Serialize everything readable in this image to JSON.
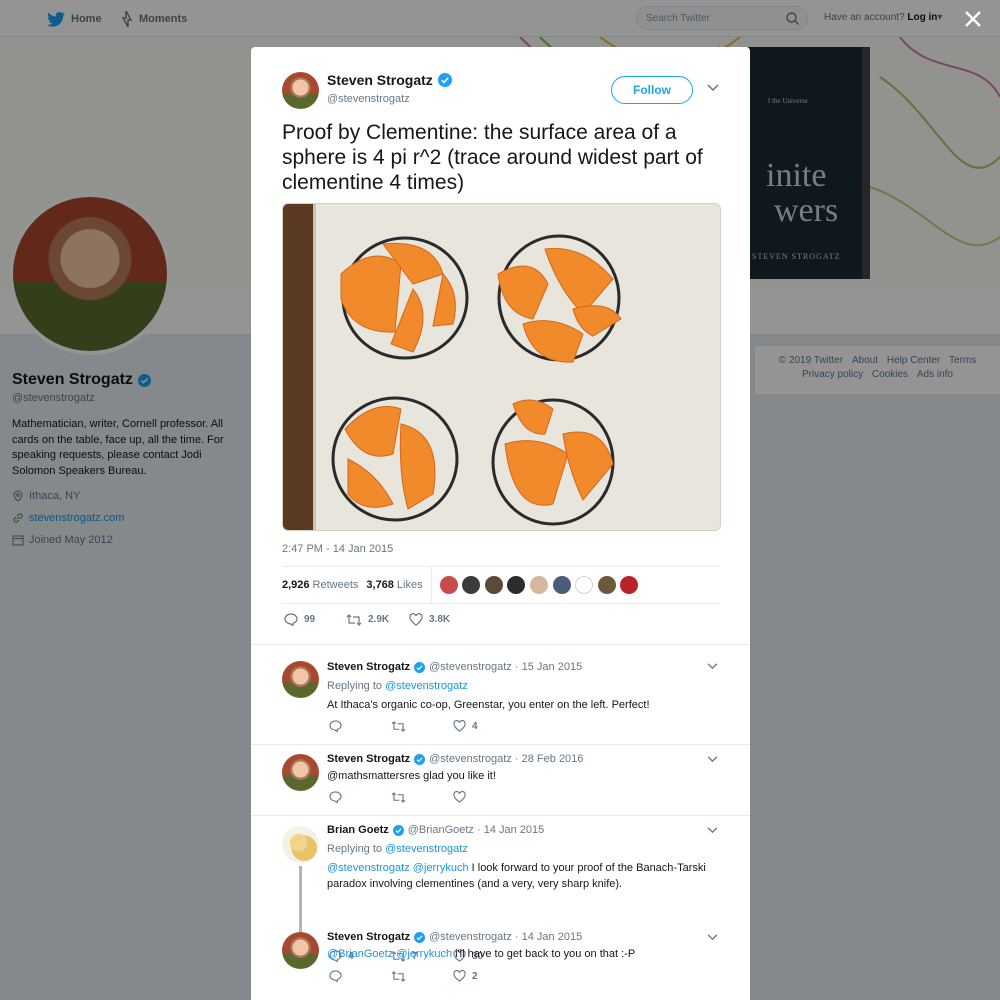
{
  "nav": {
    "home": "Home",
    "moments": "Moments",
    "search_placeholder": "Search Twitter",
    "have_account": "Have an account?",
    "login": "Log in"
  },
  "banner": {
    "book_line1": "inite",
    "book_line2": "wers",
    "book_author": "STEVEN STROGATZ",
    "book_sub1": "f the Universe"
  },
  "profile": {
    "name": "Steven Strogatz",
    "handle": "@stevenstrogatz",
    "bio": "Mathematician, writer, Cornell professor. All cards on the table, face up, all the time. For speaking requests, please contact Jodi Solomon Speakers Bureau.",
    "location": "Ithaca, NY",
    "website": "stevenstrogatz.com",
    "joined": "Joined May 2012"
  },
  "footer": {
    "copyright": "© 2019 Twitter",
    "about": "About",
    "help": "Help Center",
    "terms": "Terms",
    "privacy": "Privacy policy",
    "cookies": "Cookies",
    "ads": "Ads info"
  },
  "tweet": {
    "name": "Steven Strogatz",
    "handle": "@stevenstrogatz",
    "follow": "Follow",
    "text": "Proof by Clementine: the surface area of a sphere is 4 pi r^2 (trace around widest part of clementine 4 times)",
    "time": "2:47 PM - 14 Jan 2015",
    "retweets": "2,926",
    "retweets_label": "Retweets",
    "likes": "3,768",
    "likes_label": "Likes",
    "reply_count": "99",
    "retweet_count": "2.9K",
    "like_count": "3.8K",
    "liker_colors": [
      "#c94a4a",
      "#3b3b3b",
      "#5b4a3a",
      "#2c2c2c",
      "#d9b6a0",
      "#4d5b7a",
      "#ffffff",
      "#6b5a3a",
      "#b8242a"
    ]
  },
  "replies": [
    {
      "name": "Steven Strogatz",
      "handle": "@stevenstrogatz",
      "date": "· 15 Jan 2015",
      "replying": "Replying to",
      "replying_to": "@stevenstrogatz",
      "text": "At Ithaca's organic co-op, Greenstar, you enter on the left. Perfect!",
      "reply_count": "",
      "retweet_count": "",
      "like_count": "4"
    },
    {
      "name": "Steven Strogatz",
      "handle": "@stevenstrogatz",
      "date": "· 28 Feb 2016",
      "text": "@mathsmattersres glad you like it!",
      "reply_count": "",
      "retweet_count": "",
      "like_count": ""
    },
    {
      "name": "Brian Goetz",
      "handle": "@BrianGoetz",
      "date": "· 14 Jan 2015",
      "replying": "Replying to",
      "replying_to": "@stevenstrogatz",
      "mention1": "@stevenstrogatz",
      "mention2": "@jerrykuch",
      "text": " I look forward to your proof of the Banach-Tarski paradox involving clementines (and a very, very sharp knife).",
      "reply_count": "4",
      "retweet_count": "7",
      "like_count": "30"
    },
    {
      "name": "Steven Strogatz",
      "handle": "@stevenstrogatz",
      "date": "· 14 Jan 2015",
      "mention1": "@BrianGoetz",
      "mention2": "@jerrykuch",
      "text": " i'll have to get back to you on that :-P",
      "reply_count": "",
      "retweet_count": "",
      "like_count": "2"
    }
  ]
}
